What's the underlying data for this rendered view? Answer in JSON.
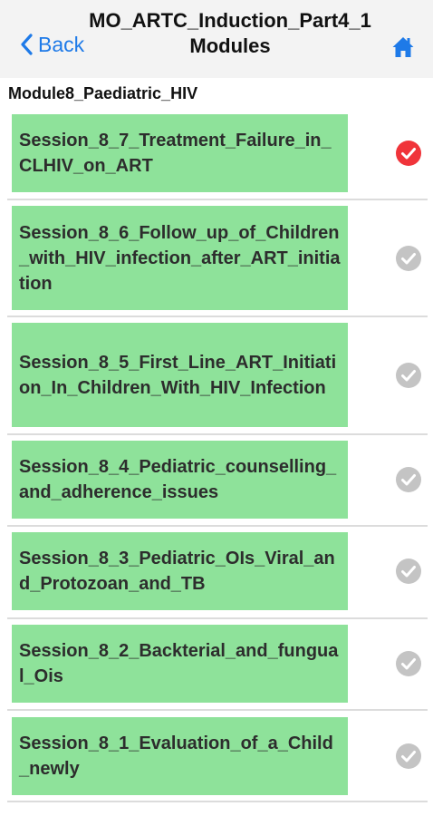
{
  "header": {
    "title": "MO_ARTC_Induction_Part4_1 Modules",
    "back_label": "Back",
    "home_icon": "home-icon",
    "accent_color": "#1e7ae8"
  },
  "module": {
    "title": "Module8_Paediatric_HIV"
  },
  "sessions": [
    {
      "label": "Session_8_7_Treatment_Failure_in_CLHIV_on_ART",
      "status": "completed"
    },
    {
      "label": "Session_8_6_Follow_up_of_Children_with_HIV_infection_after_ART_initiation",
      "status": "pending"
    },
    {
      "label": "Session_8_5_First_Line_ART_Initiation_In_Children_With_HIV_Infection",
      "status": "pending"
    },
    {
      "label": "Session_8_4_Pediatric_counselling_and_adherence_issues",
      "status": "pending"
    },
    {
      "label": "Session_8_3_Pediatric_OIs_Viral_and_Protozoan_and_TB",
      "status": "pending"
    },
    {
      "label": "Session_8_2_Backterial_and_fungual_Ois",
      "status": "pending"
    },
    {
      "label": "Session_8_1_Evaluation_of_a_Child_newly",
      "status": "pending"
    }
  ],
  "colors": {
    "card_bg": "#8ee29a",
    "completed": "#f0343a",
    "pending": "#c4c4c4"
  }
}
